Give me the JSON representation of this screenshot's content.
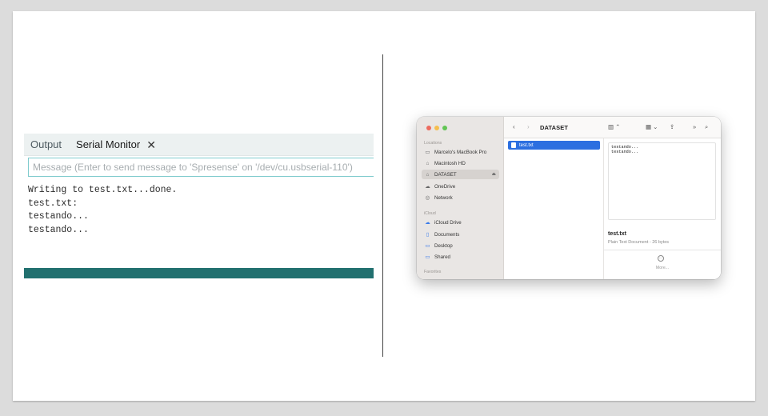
{
  "serial_monitor": {
    "tabs": [
      {
        "label": "Output"
      },
      {
        "label": "Serial Monitor"
      }
    ],
    "close_glyph": "✕",
    "message_placeholder": "Message (Enter to send message to 'Spresense' on '/dev/cu.usbserial-110')",
    "log_lines": [
      "Writing to test.txt...done.",
      "test.txt:",
      "testando...",
      "testando..."
    ],
    "status_bar_color": "#21706f"
  },
  "finder": {
    "sidebar": {
      "locations_header": "Locations",
      "locations": [
        {
          "label": "Marcelo's MacBook Pro",
          "icon": "laptop-icon"
        },
        {
          "label": "Macintosh HD",
          "icon": "disk-icon"
        },
        {
          "label": "DATASET",
          "icon": "disk-icon",
          "selected": true
        },
        {
          "label": "OneDrive",
          "icon": "cloud-icon"
        },
        {
          "label": "Network",
          "icon": "network-icon"
        }
      ],
      "icloud_header": "iCloud",
      "icloud": [
        {
          "label": "iCloud Drive",
          "icon": "cloud-icon"
        },
        {
          "label": "Documents",
          "icon": "document-icon"
        },
        {
          "label": "Desktop",
          "icon": "desktop-icon"
        },
        {
          "label": "Shared",
          "icon": "shared-folder-icon"
        }
      ],
      "favorites_header": "Favorites"
    },
    "toolbar": {
      "title": "DATASET"
    },
    "files": [
      {
        "name": "test.txt"
      }
    ],
    "preview": {
      "content": "testando...\ntestando...",
      "file_name": "test.txt",
      "file_info": "Plain Text Document - 26 bytes",
      "more_label": "More..."
    }
  }
}
